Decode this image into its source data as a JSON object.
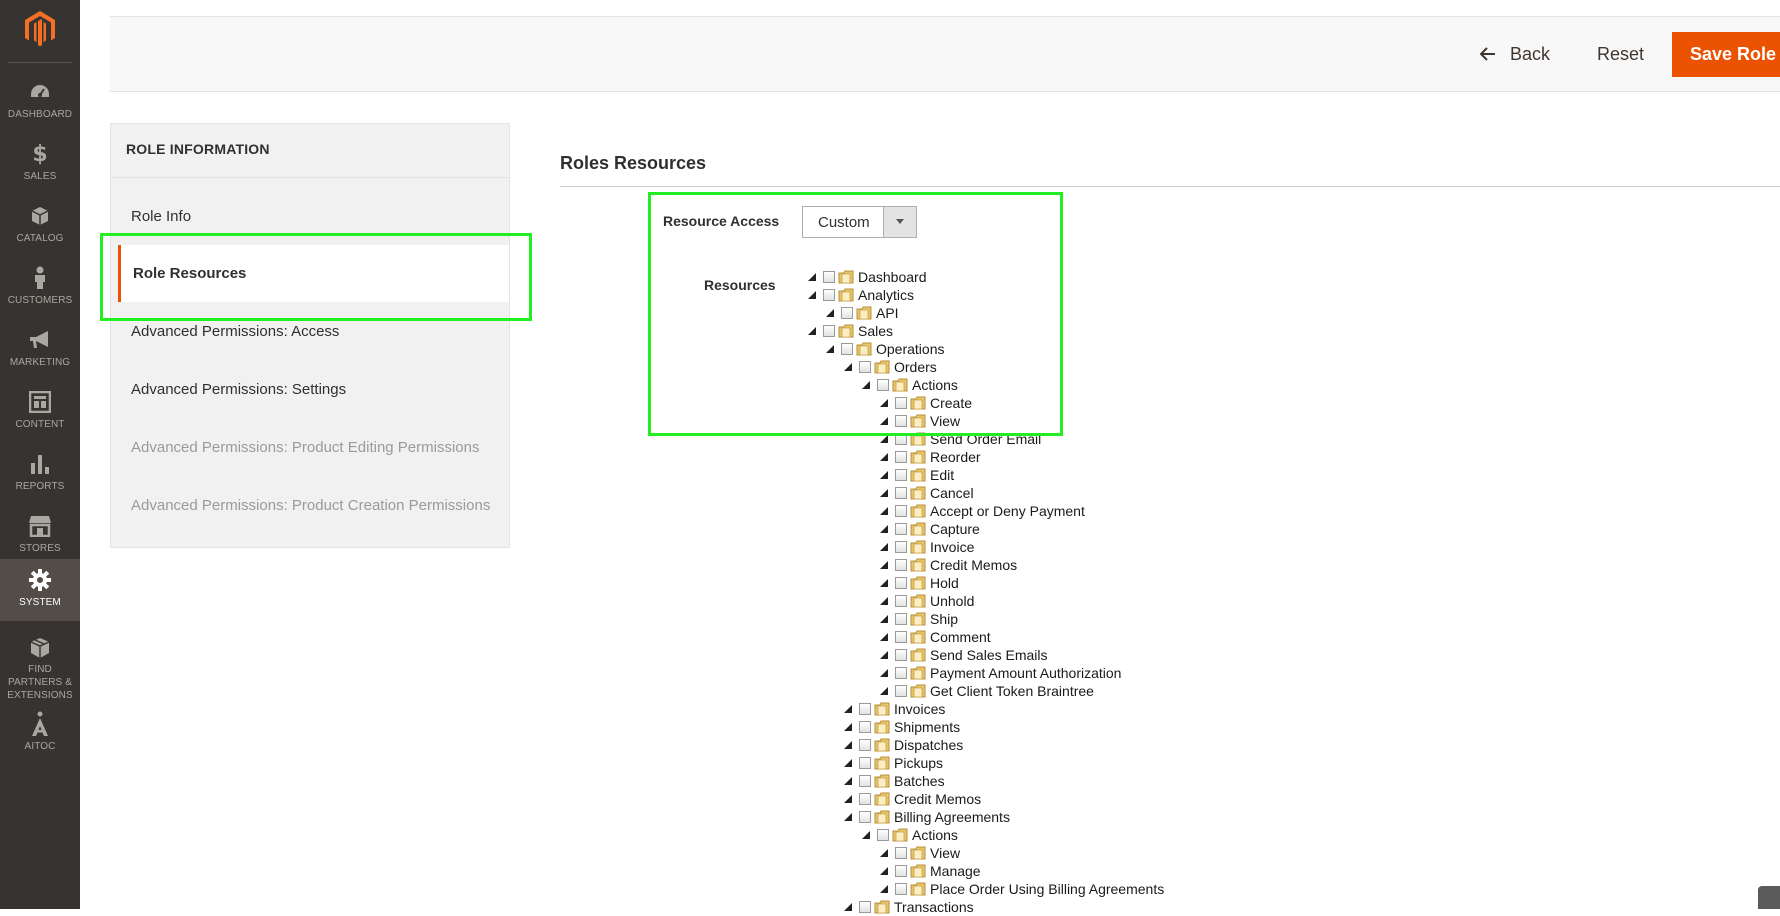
{
  "admin_menu": {
    "items": [
      {
        "label": "DASHBOARD",
        "icon": "dashboard-icon"
      },
      {
        "label": "SALES",
        "icon": "dollar-icon"
      },
      {
        "label": "CATALOG",
        "icon": "box-icon"
      },
      {
        "label": "CUSTOMERS",
        "icon": "person-icon"
      },
      {
        "label": "MARKETING",
        "icon": "megaphone-icon"
      },
      {
        "label": "CONTENT",
        "icon": "layout-icon"
      },
      {
        "label": "REPORTS",
        "icon": "bar-chart-icon"
      },
      {
        "label": "STORES",
        "icon": "store-icon"
      },
      {
        "label": "SYSTEM",
        "icon": "gear-icon"
      },
      {
        "label": "FIND PARTNERS & EXTENSIONS",
        "icon": "package-icon"
      },
      {
        "label": "AITOC",
        "icon": "aitoc-icon"
      }
    ],
    "active": "SYSTEM"
  },
  "header": {
    "back_label": "Back",
    "reset_label": "Reset",
    "save_label": "Save Role"
  },
  "side": {
    "title": "ROLE INFORMATION",
    "tabs": [
      {
        "label": "Role Info",
        "state": "normal"
      },
      {
        "label": "Role Resources",
        "state": "active"
      },
      {
        "label": "Advanced Permissions: Access",
        "state": "normal"
      },
      {
        "label": "Advanced Permissions: Settings",
        "state": "normal"
      },
      {
        "label": "Advanced Permissions: Product Editing Permissions",
        "state": "disabled"
      },
      {
        "label": "Advanced Permissions: Product Creation Permissions",
        "state": "disabled"
      }
    ]
  },
  "main": {
    "section_title": "Roles Resources",
    "resource_access_label": "Resource Access",
    "resource_access_value": "Custom",
    "resources_label": "Resources",
    "tree": [
      {
        "label": "Dashboard",
        "depth": 0
      },
      {
        "label": "Analytics",
        "depth": 0
      },
      {
        "label": "API",
        "depth": 1
      },
      {
        "label": "Sales",
        "depth": 0
      },
      {
        "label": "Operations",
        "depth": 1
      },
      {
        "label": "Orders",
        "depth": 2
      },
      {
        "label": "Actions",
        "depth": 3
      },
      {
        "label": "Create",
        "depth": 4
      },
      {
        "label": "View",
        "depth": 4
      },
      {
        "label": "Send Order Email",
        "depth": 4
      },
      {
        "label": "Reorder",
        "depth": 4
      },
      {
        "label": "Edit",
        "depth": 4
      },
      {
        "label": "Cancel",
        "depth": 4
      },
      {
        "label": "Accept or Deny Payment",
        "depth": 4
      },
      {
        "label": "Capture",
        "depth": 4
      },
      {
        "label": "Invoice",
        "depth": 4
      },
      {
        "label": "Credit Memos",
        "depth": 4
      },
      {
        "label": "Hold",
        "depth": 4
      },
      {
        "label": "Unhold",
        "depth": 4
      },
      {
        "label": "Ship",
        "depth": 4
      },
      {
        "label": "Comment",
        "depth": 4
      },
      {
        "label": "Send Sales Emails",
        "depth": 4
      },
      {
        "label": "Payment Amount Authorization",
        "depth": 4
      },
      {
        "label": "Get Client Token Braintree",
        "depth": 4
      },
      {
        "label": "Invoices",
        "depth": 2
      },
      {
        "label": "Shipments",
        "depth": 2
      },
      {
        "label": "Dispatches",
        "depth": 2
      },
      {
        "label": "Pickups",
        "depth": 2
      },
      {
        "label": "Batches",
        "depth": 2
      },
      {
        "label": "Credit Memos",
        "depth": 2
      },
      {
        "label": "Billing Agreements",
        "depth": 2
      },
      {
        "label": "Actions",
        "depth": 3
      },
      {
        "label": "View",
        "depth": 4
      },
      {
        "label": "Manage",
        "depth": 4
      },
      {
        "label": "Place Order Using Billing Agreements",
        "depth": 4
      },
      {
        "label": "Transactions",
        "depth": 2
      }
    ]
  },
  "colors": {
    "brand_orange": "#eb5202",
    "menu_bg": "#373330",
    "highlight_green": "#22ee22"
  }
}
